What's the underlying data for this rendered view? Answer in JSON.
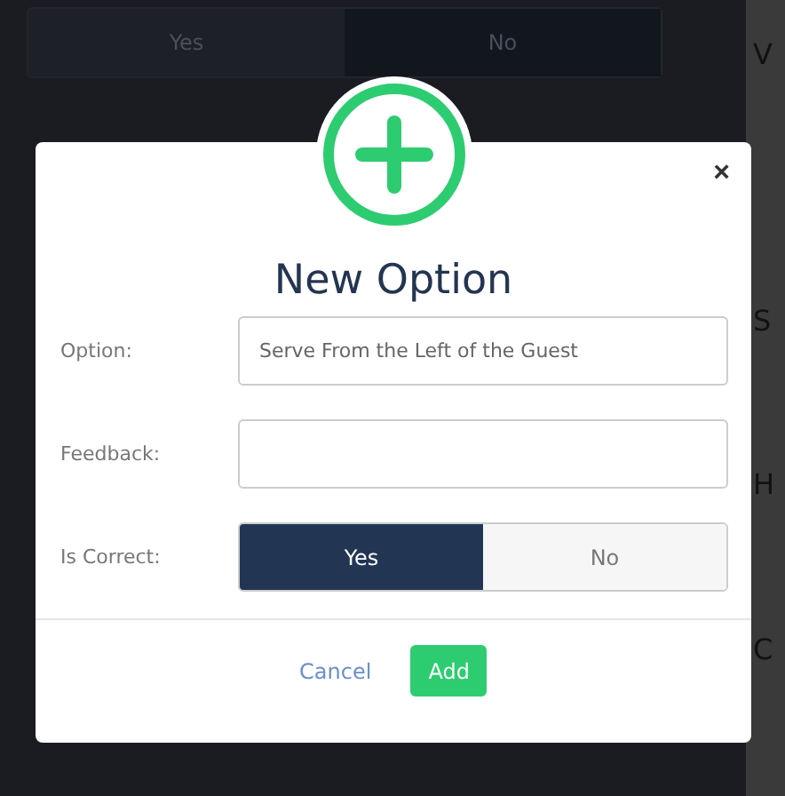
{
  "background": {
    "toggle": [
      {
        "label": "Yes",
        "selected": false
      },
      {
        "label": "No",
        "selected": true
      }
    ],
    "side_labels": [
      "V",
      "S",
      "H",
      "C"
    ]
  },
  "dialog": {
    "title": "New Option",
    "close": "×",
    "fields": [
      {
        "label": "Option:",
        "kind": "text",
        "value": "Serve From the Left of the Guest"
      },
      {
        "label": "Feedback:",
        "kind": "text"
      },
      {
        "label": "Is Correct:",
        "kind": "toggle",
        "options": [
          {
            "label": "Yes",
            "selected": true
          },
          {
            "label": "No",
            "selected": false
          }
        ]
      }
    ],
    "buttons": [
      {
        "label": "Cancel",
        "kind": "link"
      },
      {
        "label": "Add",
        "kind": "primary"
      }
    ]
  }
}
